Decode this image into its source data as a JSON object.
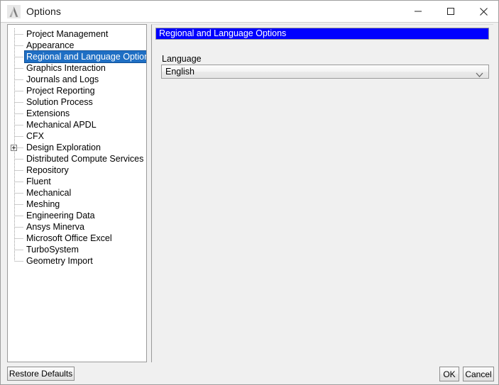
{
  "window": {
    "title": "Options",
    "app_icon": "ansys-logo-icon",
    "controls": {
      "minimize": "minimize-icon",
      "maximize": "maximize-icon",
      "close": "close-icon"
    }
  },
  "tree": {
    "items": [
      {
        "label": "Project Management",
        "selected": false,
        "expandable": false
      },
      {
        "label": "Appearance",
        "selected": false,
        "expandable": false
      },
      {
        "label": "Regional and Language Options",
        "selected": true,
        "expandable": false
      },
      {
        "label": "Graphics Interaction",
        "selected": false,
        "expandable": false
      },
      {
        "label": "Journals and Logs",
        "selected": false,
        "expandable": false
      },
      {
        "label": "Project Reporting",
        "selected": false,
        "expandable": false
      },
      {
        "label": "Solution Process",
        "selected": false,
        "expandable": false
      },
      {
        "label": "Extensions",
        "selected": false,
        "expandable": false
      },
      {
        "label": "Mechanical APDL",
        "selected": false,
        "expandable": false
      },
      {
        "label": "CFX",
        "selected": false,
        "expandable": false
      },
      {
        "label": "Design Exploration",
        "selected": false,
        "expandable": true
      },
      {
        "label": "Distributed Compute Services",
        "selected": false,
        "expandable": false
      },
      {
        "label": "Repository",
        "selected": false,
        "expandable": false
      },
      {
        "label": "Fluent",
        "selected": false,
        "expandable": false
      },
      {
        "label": "Mechanical",
        "selected": false,
        "expandable": false
      },
      {
        "label": "Meshing",
        "selected": false,
        "expandable": false
      },
      {
        "label": "Engineering Data",
        "selected": false,
        "expandable": false
      },
      {
        "label": "Ansys Minerva",
        "selected": false,
        "expandable": false
      },
      {
        "label": "Microsoft Office Excel",
        "selected": false,
        "expandable": false
      },
      {
        "label": "TurboSystem",
        "selected": false,
        "expandable": false
      },
      {
        "label": "Geometry Import",
        "selected": false,
        "expandable": false
      }
    ]
  },
  "panel": {
    "section_title": "Regional and Language Options",
    "section_title_bg": "#0000ff",
    "language": {
      "label": "Language",
      "value": "English",
      "arrow_icon": "chevron-down-icon"
    }
  },
  "footer": {
    "restore_defaults": "Restore Defaults",
    "ok": "OK",
    "cancel": "Cancel"
  },
  "colors": {
    "selection": "#1f6fc4",
    "header_blue": "#0000ff",
    "panel_bg": "#f0f0f0"
  }
}
